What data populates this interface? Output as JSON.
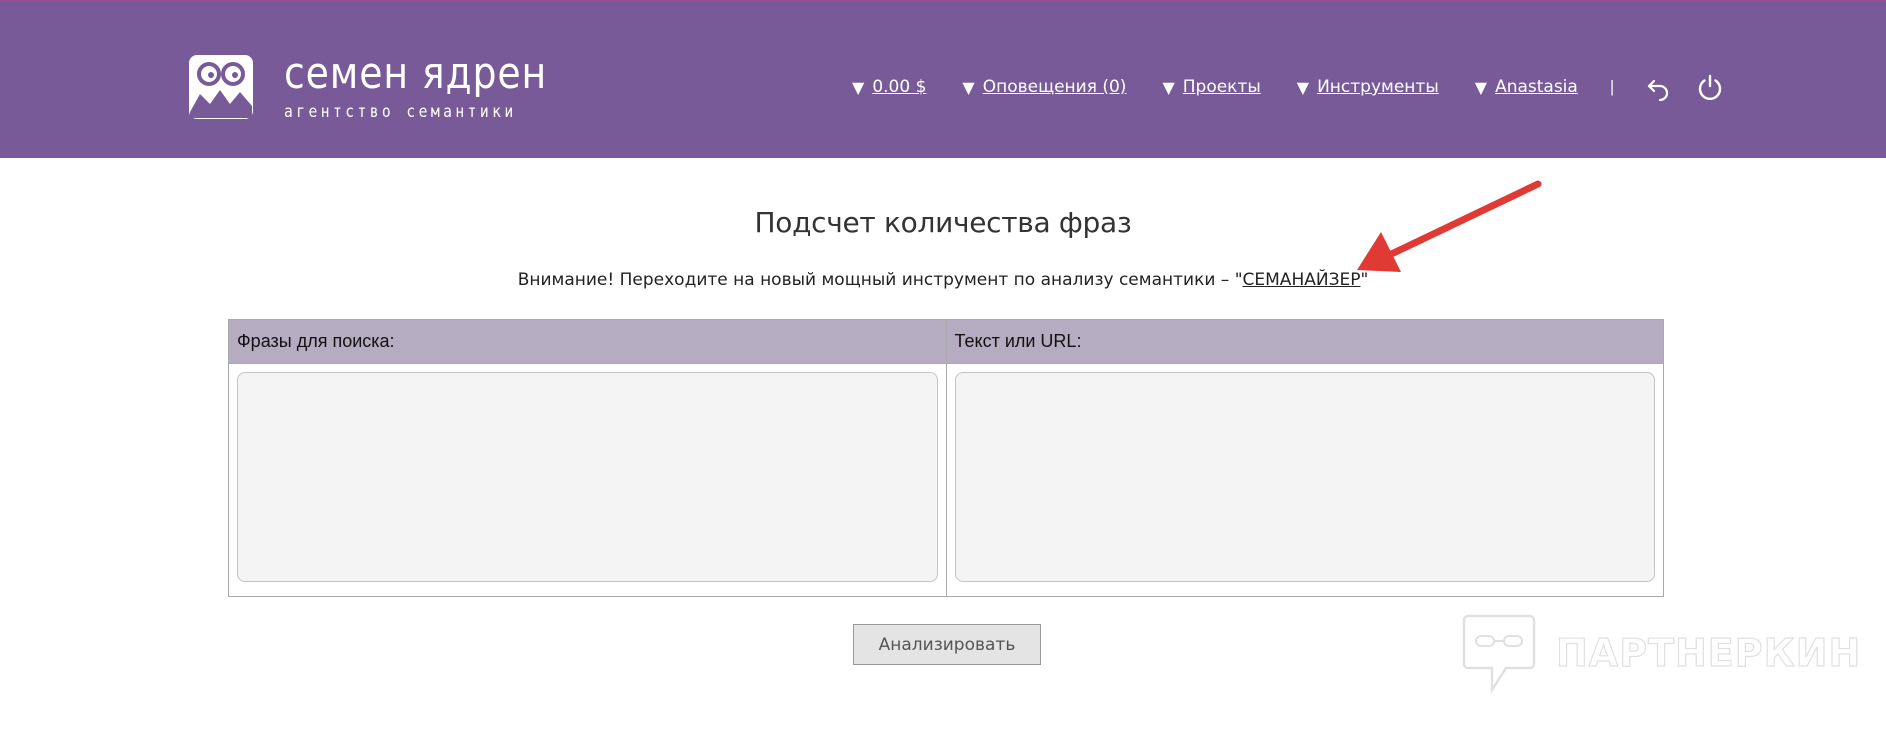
{
  "brand": {
    "title": "семен ядрен",
    "subtitle": "агентство семантики"
  },
  "nav": {
    "items": [
      {
        "label": "0.00 $"
      },
      {
        "label": "Оповещения (0)"
      },
      {
        "label": "Проекты"
      },
      {
        "label": "Инструменты"
      },
      {
        "label": "Anastasia"
      }
    ],
    "separator": "|",
    "triangle": "▼",
    "icons": [
      "undo-icon",
      "power-icon"
    ]
  },
  "main": {
    "title": "Подсчет количества фраз",
    "notice_prefix": "Внимание! Переходите на новый мощный инструмент по анализу семантики – \"",
    "notice_link": "СЕМАНАЙЗЕР",
    "notice_suffix": "\"",
    "columns": [
      {
        "header": "Фразы для поиска:",
        "value": ""
      },
      {
        "header": "Текст или URL:",
        "value": ""
      }
    ],
    "analyze_label": "Анализировать"
  },
  "watermark": {
    "text": "ПАРТНЕРКИН"
  },
  "colors": {
    "header_bg": "#785a99",
    "table_header_bg": "#b5acc2",
    "arrow": "#e03a35"
  }
}
